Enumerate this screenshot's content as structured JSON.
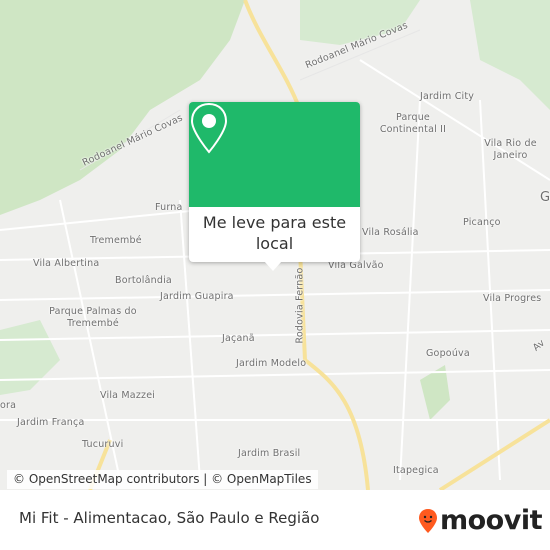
{
  "map": {
    "labels": [
      "Rodoanel Mário Covas",
      "Rodoanel Mário Covas",
      "Jardim City",
      "Parque Continental II",
      "Vila Rio de Janeiro",
      "Furna",
      "Tremembé",
      "Vila Albertina",
      "Bortolândia",
      "Jardim Guapira",
      "Parque Palmas do Tremembé",
      "Jaçanã",
      "Jardim Modelo",
      "Vila Mazzei",
      "Jardim França",
      "Tucuruvi",
      "Jardim Brasil",
      "Itapegica",
      "Vila Rosália",
      "Picanço",
      "Vila Galvão",
      "Vila Progres",
      "Gopoúva",
      "Rodovia Fernão",
      "Av",
      "ora",
      "G"
    ],
    "colors": {
      "background": "#efefed",
      "park": "#cfe6c4",
      "highway": "#f7e29a"
    }
  },
  "popup": {
    "action_label": "Me leve para este local",
    "icon": "map-pin-icon",
    "color": "#1fb96a"
  },
  "attribution": "© OpenStreetMap contributors | © OpenMapTiles",
  "footer": {
    "title": "Mi Fit - Alimentacao, São Paulo e Região",
    "logo_text": "moovit",
    "logo_color": "#ff5a1f"
  }
}
